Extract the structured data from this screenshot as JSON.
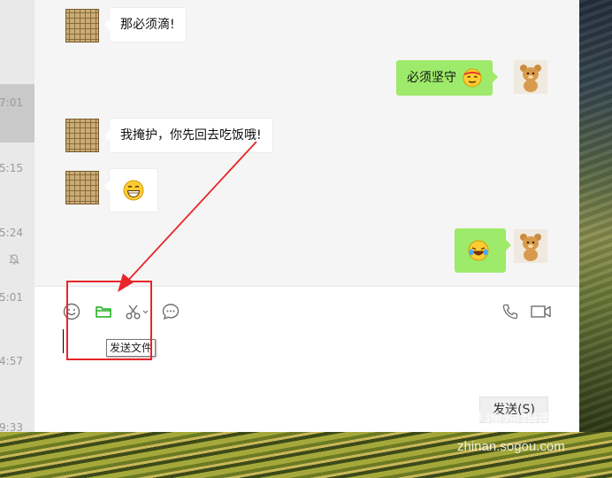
{
  "session_list": {
    "times": [
      "7:01",
      "5:15",
      "5:24",
      "5:01",
      "4:57",
      "9:33"
    ]
  },
  "messages": [
    {
      "side": "in",
      "avatar": "chess-board-avatar",
      "text": "那必须滴!"
    },
    {
      "side": "out",
      "avatar": "bear-avatar",
      "text": "必须坚守",
      "emoji": "determined-face-emoji"
    },
    {
      "side": "in",
      "avatar": "chess-board-avatar",
      "text": "我掩护，你先回去吃饭哦!"
    },
    {
      "side": "in",
      "avatar": "chess-board-avatar",
      "emoji": "grinning-face-emoji"
    },
    {
      "side": "out",
      "avatar": "bear-avatar",
      "emoji": "laughing-tears-emoji"
    }
  ],
  "toolbar": {
    "icons": [
      "emoji-icon",
      "folder-icon",
      "scissors-icon",
      "chat-bubble-icon",
      "phone-icon",
      "video-icon"
    ],
    "tooltip": "发送文件"
  },
  "input": {
    "value": ""
  },
  "send_button": {
    "label": "发送(S)"
  },
  "annotation": {
    "color": "#e8262a"
  },
  "watermark": {
    "brand": "搜狗指南",
    "url": "zhinan.sogou.com"
  },
  "colors": {
    "outgoing_bubble": "#9eea6a",
    "incoming_bubble": "#ffffff",
    "chat_bg": "#f5f5f5"
  }
}
